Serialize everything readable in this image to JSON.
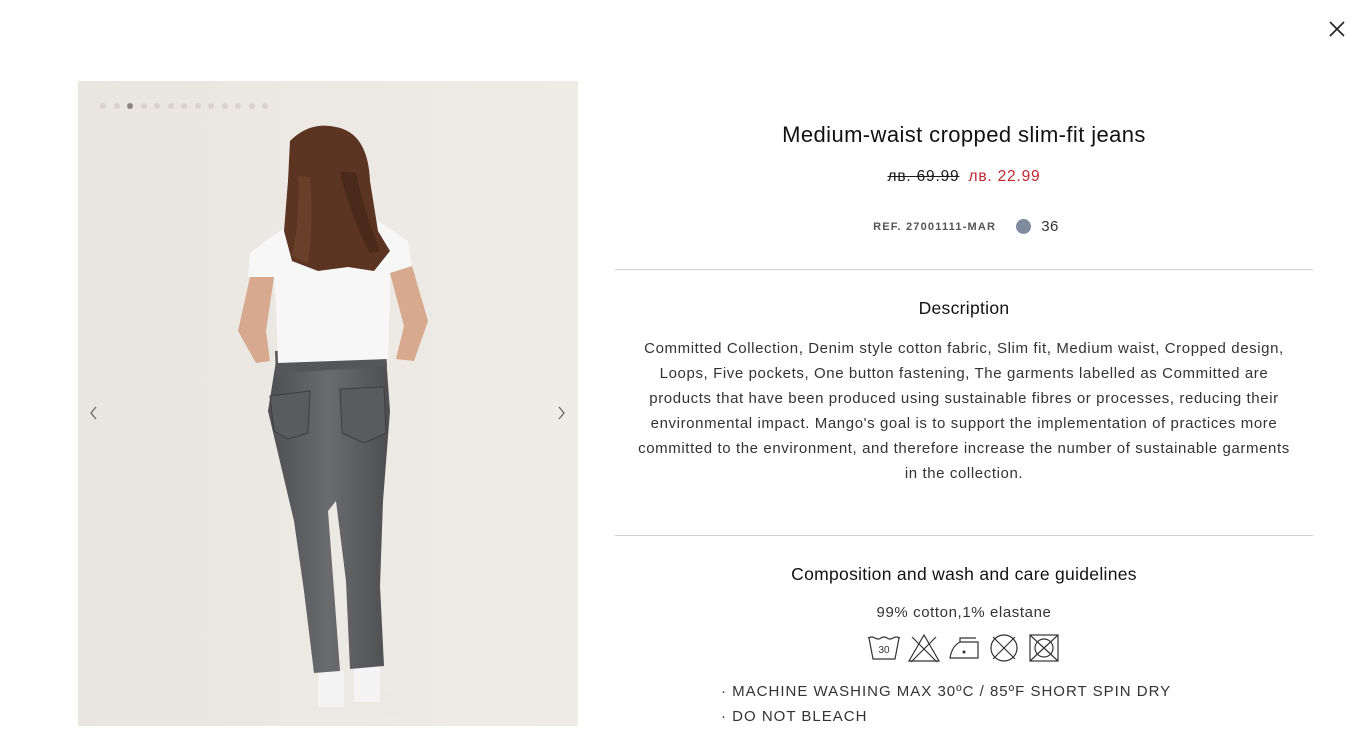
{
  "product": {
    "title": "Medium-waist cropped slim-fit jeans",
    "price_original": "лв. 69.99",
    "price_sale": "лв. 22.99",
    "ref": "REF. 27001111-MAR",
    "color_swatch": "#7f8ca0",
    "size": "36"
  },
  "gallery": {
    "image_count": 13,
    "active_index": 2,
    "background": "#ebe7e1"
  },
  "description": {
    "heading": "Description",
    "text": "Committed Collection, Denim style cotton fabric, Slim fit, Medium waist, Cropped design, Loops, Five pockets, One button fastening, The garments labelled as Committed are products that have been produced using sustainable fibres or processes, reducing their environmental impact. Mango's goal is to support the implementation of practices more committed to the environment, and therefore increase the number of sustainable garments in the collection."
  },
  "composition": {
    "heading": "Composition and wash and care guidelines",
    "materials": "99% cotton,1% elastane",
    "care_icons": [
      "wash-30-icon",
      "no-bleach-icon",
      "iron-low-icon",
      "no-tumble-dry-icon",
      "no-dryclean-icon"
    ],
    "wash_temp_label": "30",
    "instructions": [
      "· MACHINE WASHING MAX 30ºC / 85ºF SHORT SPIN DRY",
      "· DO NOT BLEACH"
    ]
  },
  "colors": {
    "sale_price": "#c0272d",
    "divider": "#cfcfcf"
  }
}
